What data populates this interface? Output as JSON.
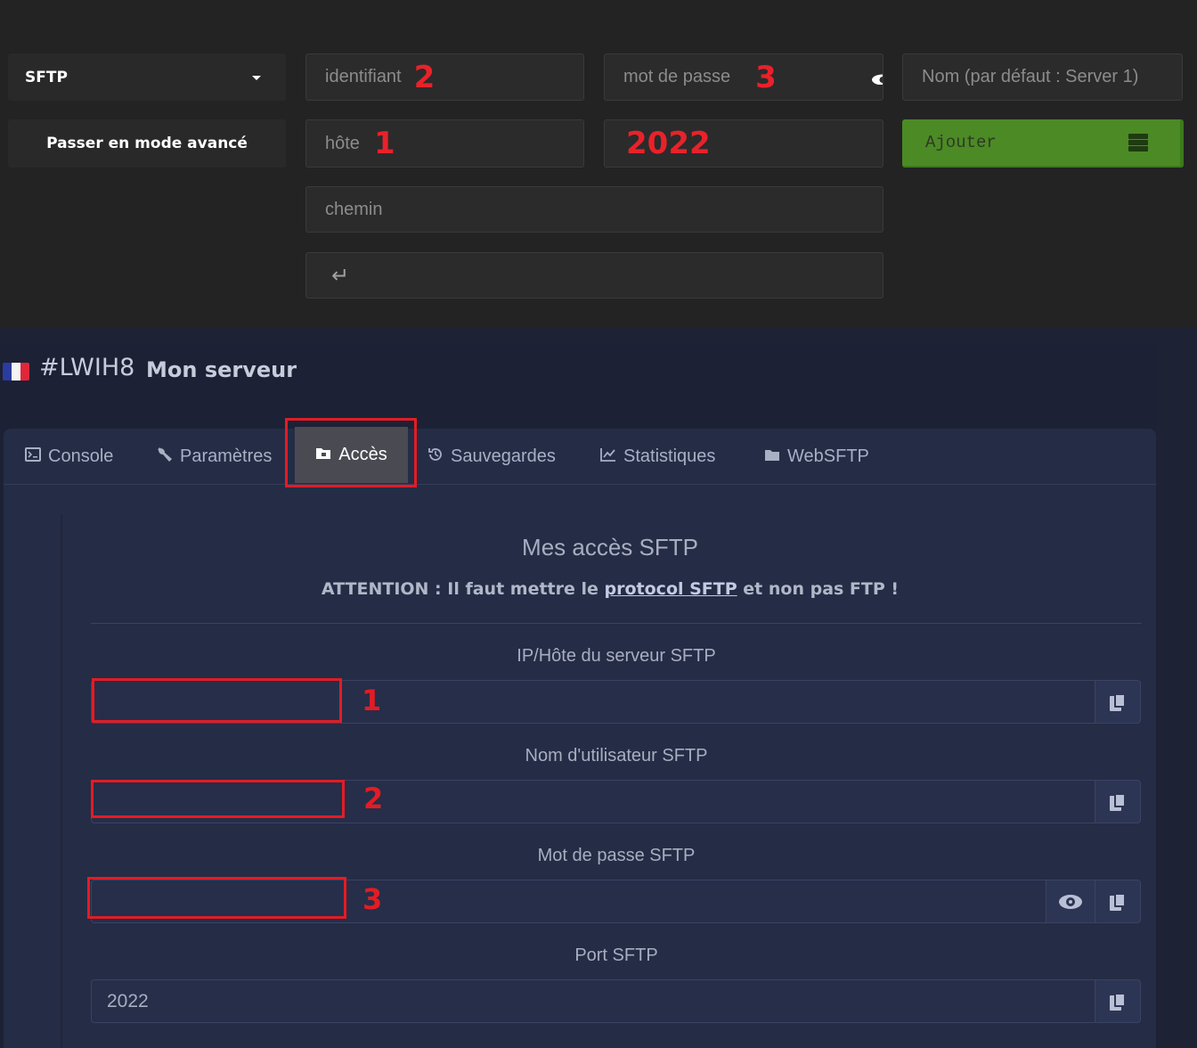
{
  "top_form": {
    "protocol_select": "SFTP",
    "advanced_button": "Passer en mode avancé",
    "username_placeholder": "identifiant",
    "username_marker": "2",
    "password_placeholder": "mot de passe",
    "password_marker": "3",
    "name_placeholder": "Nom (par défaut : Server 1)",
    "host_placeholder": "hôte",
    "host_marker": "1",
    "port_value": "2022",
    "add_button": "Ajouter",
    "path_placeholder": "chemin",
    "enter_symbol": "↵"
  },
  "server": {
    "id": "#LWIH8",
    "name": "Mon serveur"
  },
  "tabs": [
    {
      "label": "Console",
      "icon": "terminal-icon"
    },
    {
      "label": "Paramètres",
      "icon": "wrench-icon"
    },
    {
      "label": "Accès",
      "icon": "folder-lock-icon",
      "active": true
    },
    {
      "label": "Sauvegardes",
      "icon": "history-icon"
    },
    {
      "label": "Statistiques",
      "icon": "chart-line-icon"
    },
    {
      "label": "WebSFTP",
      "icon": "folder-icon"
    }
  ],
  "access": {
    "title": "Mes accès SFTP",
    "warning_prefix": "ATTENTION : Il faut mettre le ",
    "warning_link": "protocol SFTP",
    "warning_suffix": " et non pas FTP !",
    "host_label": "IP/Hôte du serveur SFTP",
    "host_value": "",
    "host_marker": "1",
    "user_label": "Nom d'utilisateur SFTP",
    "user_value": "",
    "user_marker": "2",
    "password_label": "Mot de passe SFTP",
    "password_value": "",
    "password_marker": "3",
    "port_label": "Port SFTP",
    "port_value": "2022"
  },
  "colors": {
    "annotation_red": "#e31c24",
    "add_green": "#4b8a25",
    "panel_dark": "#232323",
    "card_bg": "#252c46"
  }
}
